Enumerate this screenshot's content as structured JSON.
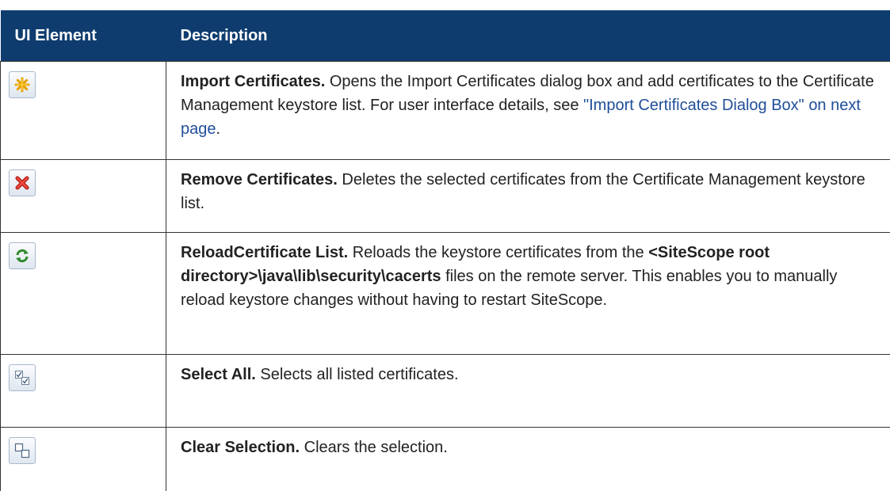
{
  "header": {
    "col1": "UI Element",
    "col2": "Description"
  },
  "rows": [
    {
      "icon": "import-star-icon",
      "name": "Import Certificates.",
      "text": " Opens the Import Certificates dialog box and add certificates to the Certificate Management keystore list. For user interface details, see ",
      "link": "\"Import Certificates Dialog Box\" on next page",
      "after": "."
    },
    {
      "icon": "delete-x-icon",
      "name": "Remove Certificates.",
      "text": " Deletes the selected certificates from the Certificate Management keystore list."
    },
    {
      "icon": "refresh-icon",
      "name": "ReloadCertificate List.",
      "text1": " Reloads the keystore certificates from the ",
      "path": "<SiteScope root directory>\\java\\lib\\security\\cacerts",
      "text2": " files on the remote server. This enables you to manually reload keystore changes without having to restart SiteScope."
    },
    {
      "icon": "select-all-icon",
      "name": "Select All.",
      "text": " Selects all listed certificates."
    },
    {
      "icon": "clear-selection-icon",
      "name": "Clear Selection.",
      "text": " Clears the selection."
    }
  ],
  "colors": {
    "header_bg": "#0e3c6e",
    "link": "#1f4e99"
  }
}
